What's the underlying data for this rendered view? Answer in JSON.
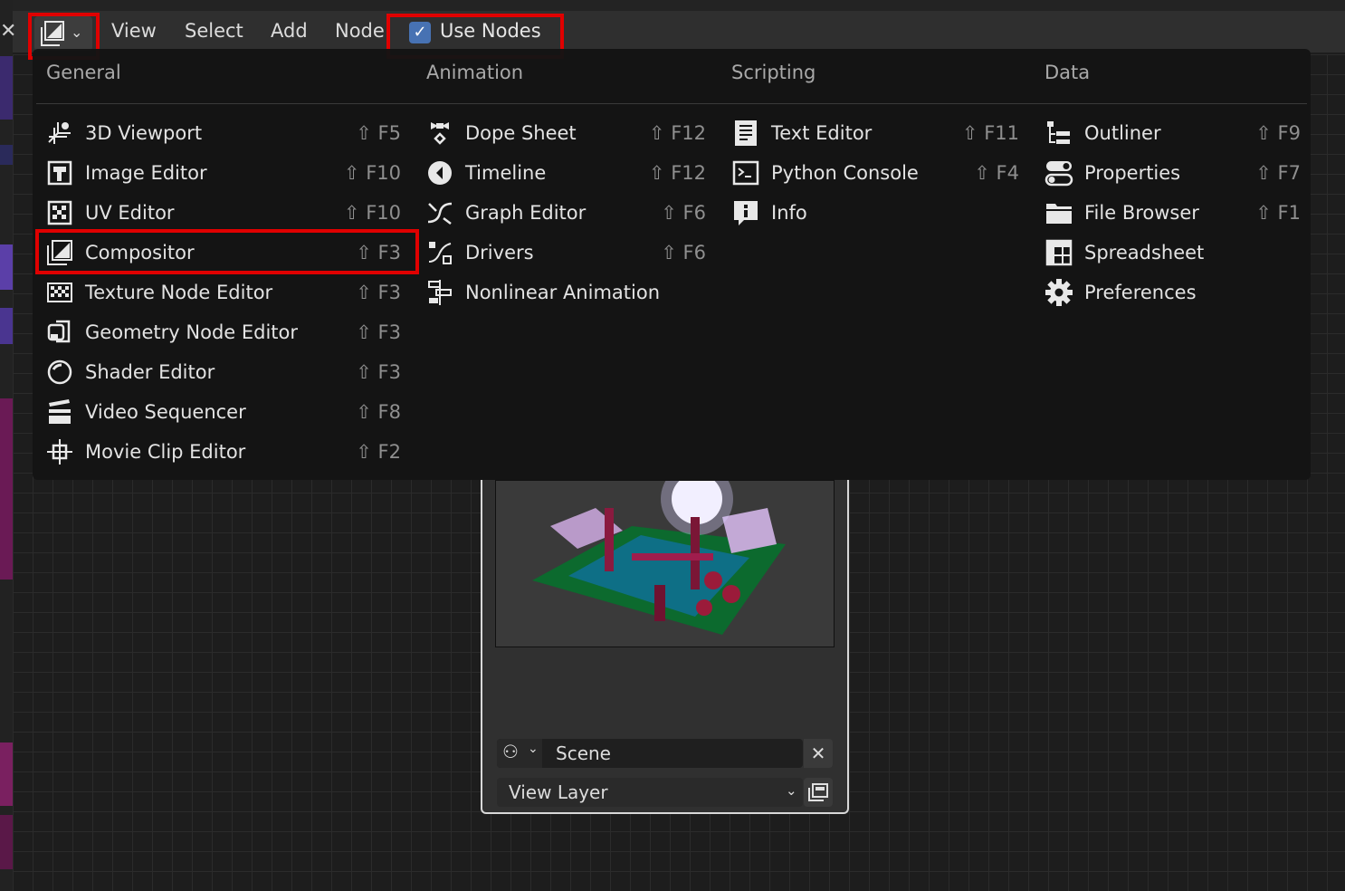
{
  "header": {
    "menus": [
      "View",
      "Select",
      "Add",
      "Node"
    ],
    "use_nodes_label": "Use Nodes",
    "use_nodes_checked": true,
    "editor_type_icon": "compositor-icon"
  },
  "editor_menu": {
    "columns": [
      {
        "heading": "General",
        "items": [
          {
            "label": "3D Viewport",
            "shortcut": "⇧ F5",
            "icon": "3d-viewport-icon"
          },
          {
            "label": "Image Editor",
            "shortcut": "⇧ F10",
            "icon": "image-editor-icon"
          },
          {
            "label": "UV Editor",
            "shortcut": "⇧ F10",
            "icon": "uv-editor-icon"
          },
          {
            "label": "Compositor",
            "shortcut": "⇧ F3",
            "icon": "compositor-icon"
          },
          {
            "label": "Texture Node Editor",
            "shortcut": "⇧ F3",
            "icon": "texture-node-icon"
          },
          {
            "label": "Geometry Node Editor",
            "shortcut": "⇧ F3",
            "icon": "geometry-node-icon"
          },
          {
            "label": "Shader Editor",
            "shortcut": "⇧ F3",
            "icon": "shader-editor-icon"
          },
          {
            "label": "Video Sequencer",
            "shortcut": "⇧ F8",
            "icon": "video-sequencer-icon"
          },
          {
            "label": "Movie Clip Editor",
            "shortcut": "⇧ F2",
            "icon": "movie-clip-icon"
          }
        ]
      },
      {
        "heading": "Animation",
        "items": [
          {
            "label": "Dope Sheet",
            "shortcut": "⇧ F12",
            "icon": "dope-sheet-icon"
          },
          {
            "label": "Timeline",
            "shortcut": "⇧ F12",
            "icon": "timeline-icon"
          },
          {
            "label": "Graph Editor",
            "shortcut": "⇧ F6",
            "icon": "graph-editor-icon"
          },
          {
            "label": "Drivers",
            "shortcut": "⇧ F6",
            "icon": "drivers-icon"
          },
          {
            "label": "Nonlinear Animation",
            "shortcut": "",
            "icon": "nla-icon"
          }
        ]
      },
      {
        "heading": "Scripting",
        "items": [
          {
            "label": "Text Editor",
            "shortcut": "⇧ F11",
            "icon": "text-editor-icon"
          },
          {
            "label": "Python Console",
            "shortcut": "⇧ F4",
            "icon": "python-console-icon"
          },
          {
            "label": "Info",
            "shortcut": "",
            "icon": "info-icon"
          }
        ]
      },
      {
        "heading": "Data",
        "items": [
          {
            "label": "Outliner",
            "shortcut": "⇧ F9",
            "icon": "outliner-icon"
          },
          {
            "label": "Properties",
            "shortcut": "⇧ F7",
            "icon": "properties-icon"
          },
          {
            "label": "File Browser",
            "shortcut": "⇧ F1",
            "icon": "file-browser-icon"
          },
          {
            "label": "Spreadsheet",
            "shortcut": "",
            "icon": "spreadsheet-icon"
          },
          {
            "label": "Preferences",
            "shortcut": "",
            "icon": "preferences-icon"
          }
        ]
      }
    ]
  },
  "node": {
    "scene_label": "Scene",
    "view_layer_label": "View Layer"
  },
  "colors": {
    "highlight": "#e00000",
    "checkbox": "#4772b3"
  }
}
